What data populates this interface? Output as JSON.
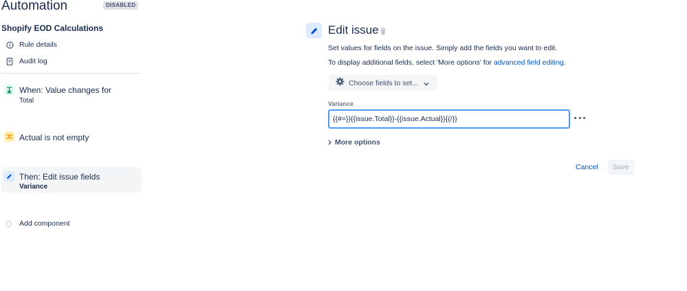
{
  "header": {
    "title": "Automation",
    "status_badge": "DISABLED"
  },
  "sidebar": {
    "rule_name": "Shopify EOD Calculations",
    "nav": [
      {
        "label": "Rule details",
        "icon": "info-icon"
      },
      {
        "label": "Audit log",
        "icon": "document-icon"
      }
    ],
    "components": [
      {
        "title": "When: Value changes for",
        "subtitle": "Total",
        "icon": "trigger-icon",
        "icon_bg": "#E3FCEF",
        "icon_color": "#00875A"
      },
      {
        "title": "Actual is not empty",
        "subtitle": "",
        "icon": "shuffle-icon",
        "icon_bg": "#FFF0B3",
        "icon_color": "#FF8B00"
      },
      {
        "title": "Then: Edit issue fields",
        "subtitle": "Variance",
        "icon": "pencil-icon",
        "icon_bg": "#DEEBFF",
        "icon_color": "#0052CC",
        "selected": true
      }
    ],
    "add_component": "Add component"
  },
  "panel": {
    "title": "Edit issue",
    "description": "Set values for fields on the issue. Simply add the fields you want to edit.",
    "hint_prefix": "To display additional fields, select 'More options' for ",
    "hint_link": "advanced field editing",
    "hint_suffix": ".",
    "choose_fields_label": "Choose fields to set...",
    "field": {
      "label": "Variance",
      "value": "{{#=}}{{issue.Total}}-{{issue.Actual}}{{/}}"
    },
    "more_options_label": "More options",
    "cancel_label": "Cancel",
    "save_label": "Save"
  },
  "colors": {
    "accent": "#0052CC",
    "focus_border": "#4C9AFF",
    "text": "#172B4D"
  }
}
